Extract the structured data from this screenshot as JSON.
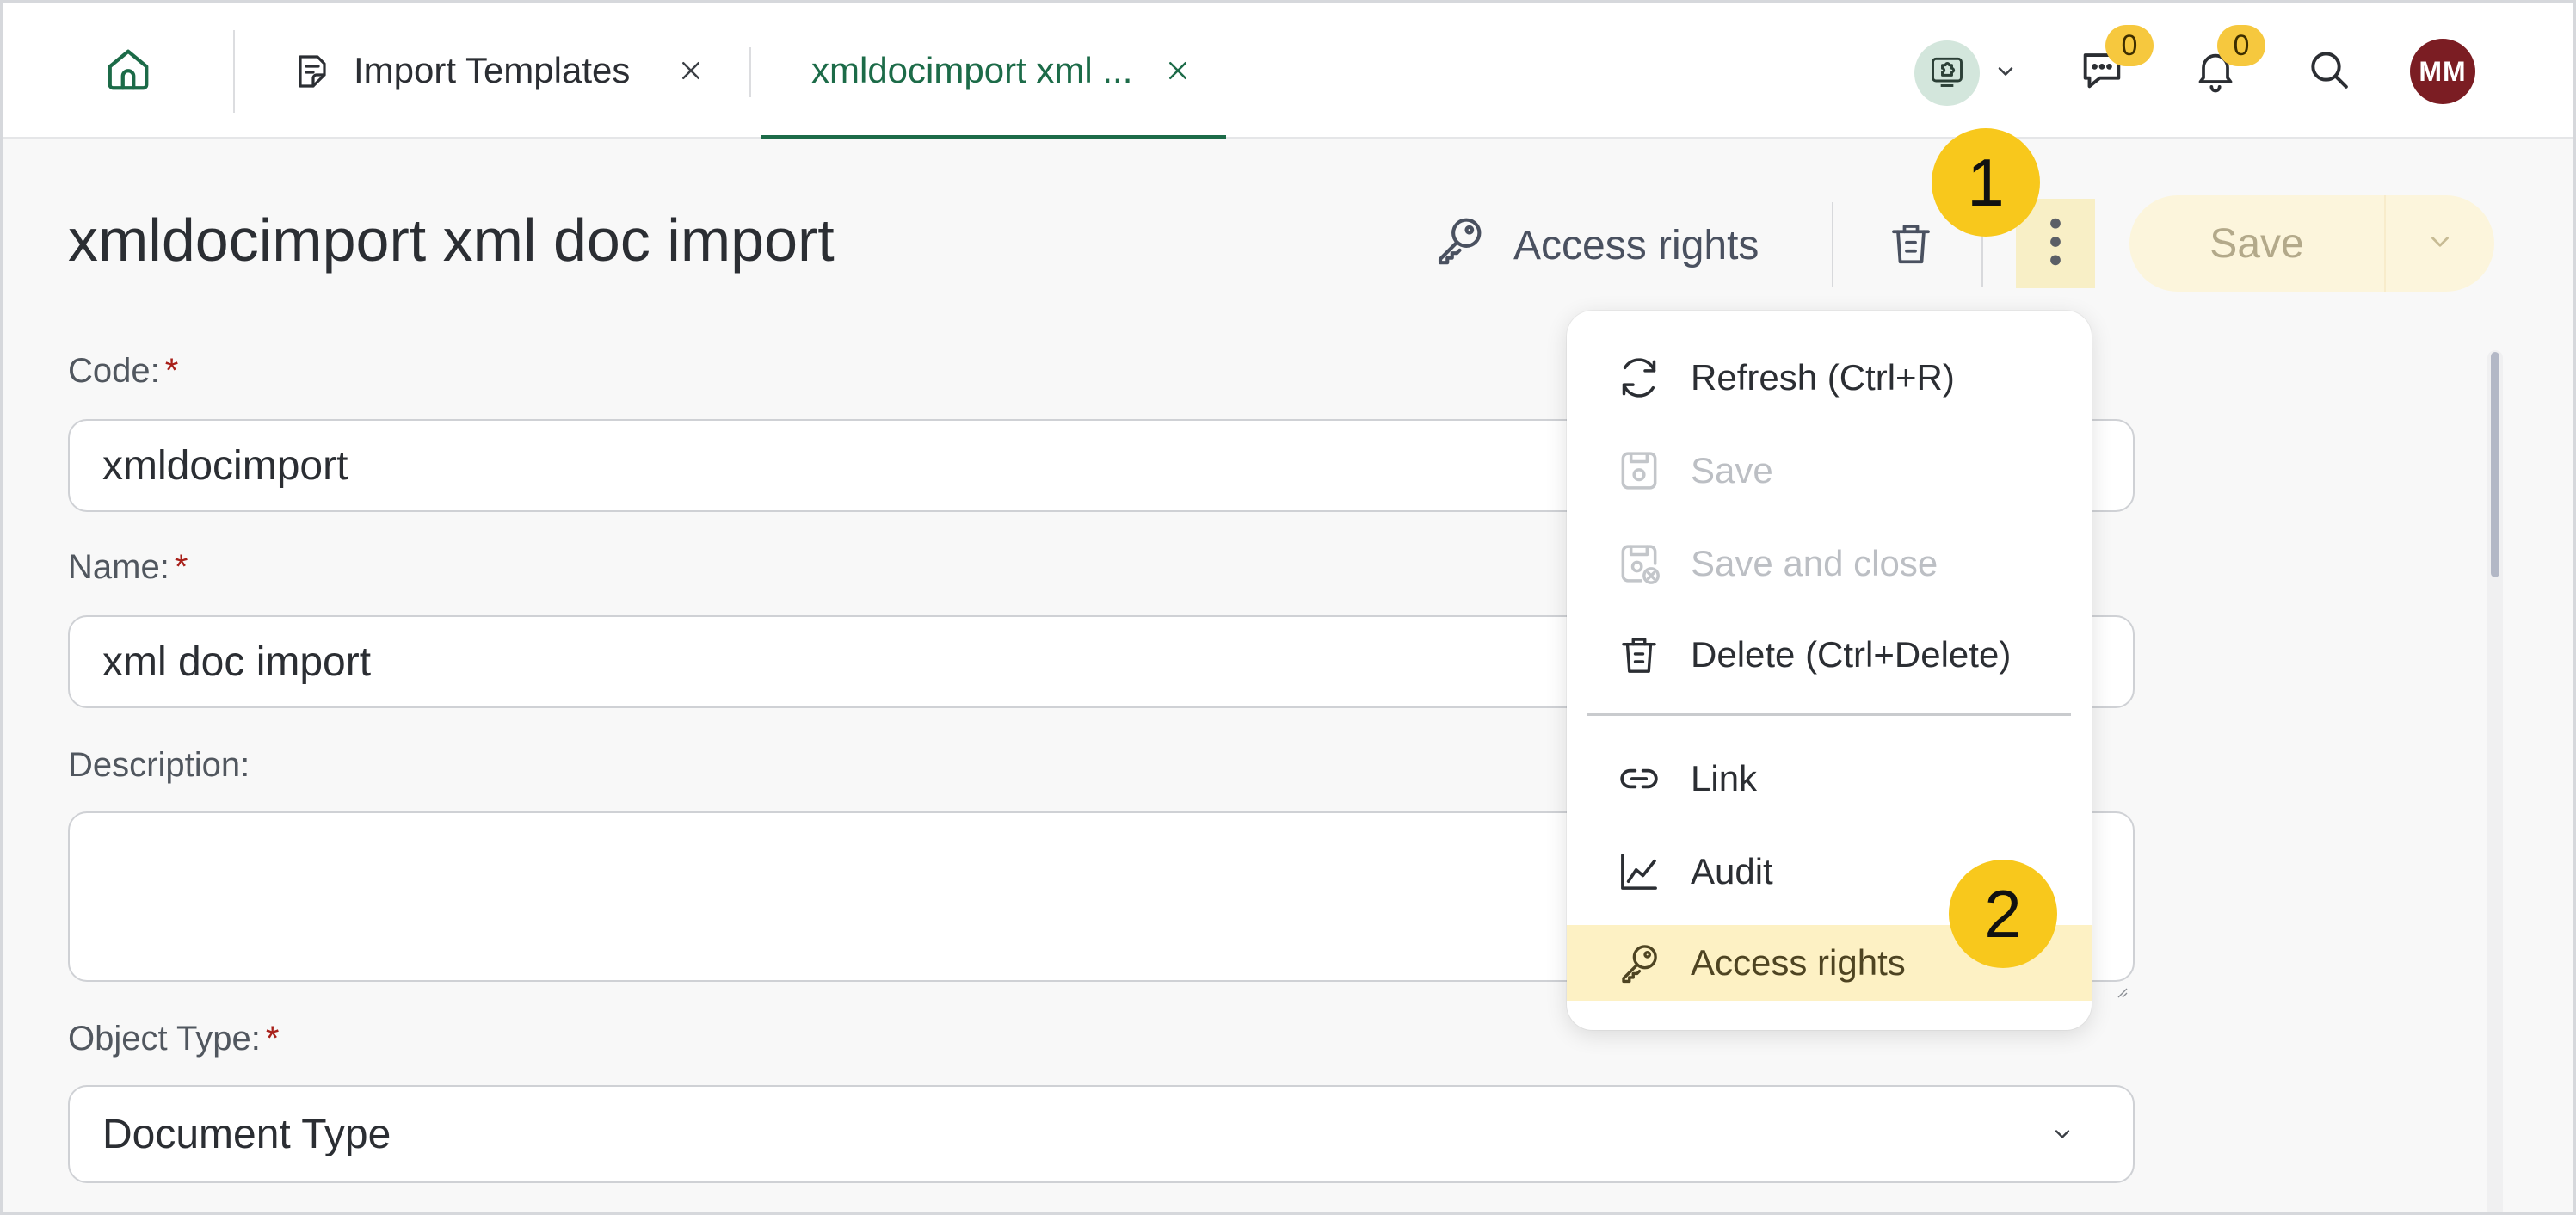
{
  "topbar": {
    "tabs": [
      {
        "label": "Import Templates",
        "active": false
      },
      {
        "label": "xmldocimport xml ...",
        "active": true
      }
    ],
    "chat_badge": "0",
    "notification_badge": "0",
    "avatar_initials": "MM"
  },
  "page": {
    "title": "xmldocimport xml doc import",
    "access_rights_label": "Access rights",
    "save_label": "Save"
  },
  "form": {
    "code": {
      "label": "Code:",
      "required_mark": "*",
      "value": "xmldocimport"
    },
    "name": {
      "label": "Name:",
      "required_mark": "*",
      "value": "xml doc import"
    },
    "description": {
      "label": "Description:",
      "value": ""
    },
    "object_type": {
      "label": "Object Type:",
      "required_mark": "*",
      "value": "Document Type"
    }
  },
  "menu": {
    "items": [
      {
        "label": "Refresh (Ctrl+R)",
        "icon": "refresh-icon",
        "disabled": false
      },
      {
        "label": "Save",
        "icon": "save-icon",
        "disabled": true
      },
      {
        "label": "Save and close",
        "icon": "save-close-icon",
        "disabled": true
      },
      {
        "label": "Delete (Ctrl+Delete)",
        "icon": "trash-icon",
        "disabled": false
      },
      {
        "label": "Link",
        "icon": "link-icon",
        "disabled": false
      },
      {
        "label": "Audit",
        "icon": "chart-line-icon",
        "disabled": false
      },
      {
        "label": "Access rights",
        "icon": "key-icon",
        "disabled": false,
        "highlighted": true
      }
    ]
  },
  "callouts": [
    "1",
    "2"
  ],
  "colors": {
    "accent_green": "#1c6b48",
    "badge_yellow": "#f6c83e",
    "callout_yellow": "#f8c81c",
    "highlight": "#fdf1c4",
    "avatar_bg": "#7b1d23",
    "required_red": "#a8201a"
  }
}
